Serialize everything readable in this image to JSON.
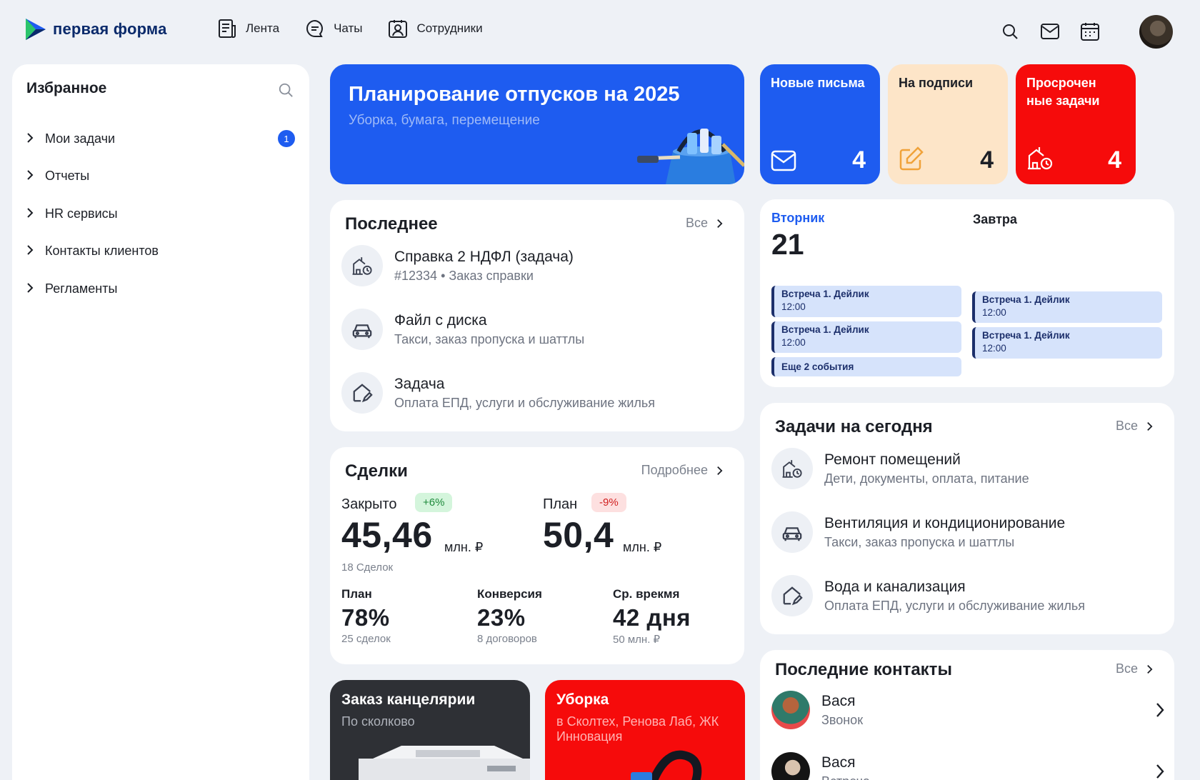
{
  "header": {
    "logo_text": "первая форма",
    "nav": [
      {
        "label": "Лента",
        "icon": "feed-icon"
      },
      {
        "label": "Чаты",
        "icon": "chat-icon"
      },
      {
        "label": "Сотрудники",
        "icon": "employees-icon"
      }
    ],
    "icons": [
      "search-icon",
      "mail-icon",
      "calendar-icon"
    ]
  },
  "sidebar": {
    "title": "Избранное",
    "items": [
      {
        "label": "Мои задачи",
        "badge": "1"
      },
      {
        "label": "Отчеты"
      },
      {
        "label": "HR сервисы"
      },
      {
        "label": "Контакты клиентов"
      },
      {
        "label": "Регламенты"
      }
    ]
  },
  "banner": {
    "title": "Планирование отпусков на 2025",
    "subtitle": "Уборка, бумага, перемещение"
  },
  "tiles": [
    {
      "title": "Новые письма",
      "count": "4",
      "bg": "#1e5cf0",
      "fg": "#ffffff",
      "icon": "mail-icon"
    },
    {
      "title": "На подписи",
      "count": "4",
      "bg": "#fde5c8",
      "fg": "#1c1f26",
      "icon": "edit-icon"
    },
    {
      "title": "Просрочен ные задачи",
      "count": "4",
      "bg": "#f60b0b",
      "fg": "#ffffff",
      "icon": "building-clock-icon"
    }
  ],
  "recent": {
    "title": "Последнее",
    "more": "Все",
    "items": [
      {
        "title": "Справка 2 НДФЛ (задача)",
        "sub_id": "#12334",
        "sub": "• Заказ справки",
        "icon": "building-clock-icon"
      },
      {
        "title": "Файл с диска",
        "sub": "Такси, заказ пропуска и шаттлы",
        "icon": "car-icon"
      },
      {
        "title": "Задача",
        "sub": "Оплата ЕПД, услуги и обслуживание жилья",
        "icon": "house-edit-icon"
      }
    ]
  },
  "deals": {
    "title": "Сделки",
    "more": "Подробнее",
    "closed": {
      "label": "Закрыто",
      "delta": "+6%",
      "value": "45,46",
      "unit": "млн. ₽",
      "count": "18 Сделок"
    },
    "plan": {
      "label": "План",
      "delta": "-9%",
      "value": "50,4",
      "unit": "млн. ₽"
    },
    "stats": [
      {
        "label": "План",
        "value": "78%",
        "sub": "25 сделок"
      },
      {
        "label": "Конверсия",
        "value": "23%",
        "sub": "8 договоров"
      },
      {
        "label": "Ср. врекмя",
        "value": "42 дня",
        "sub": "50 млн. ₽"
      }
    ]
  },
  "promos": [
    {
      "title": "Заказ канцелярии",
      "subtitle": "По сколково",
      "bg": "#2e3035"
    },
    {
      "title": "Уборка",
      "subtitle": "в Сколтех, Ренова Лаб, ЖК Инновация",
      "bg": "#f60b0b"
    }
  ],
  "calendar": {
    "today_label": "Вторник",
    "today_date": "21",
    "tomorrow_label": "Завтра",
    "today_events": [
      {
        "title": "Встреча 1. Дейлик",
        "time": "12:00"
      },
      {
        "title": "Встреча 1. Дейлик",
        "time": "12:00"
      }
    ],
    "today_more": "Еще 2 события",
    "tomorrow_events": [
      {
        "title": "Встреча 1. Дейлик",
        "time": "12:00"
      },
      {
        "title": "Встреча 1. Дейлик",
        "time": "12:00"
      }
    ]
  },
  "tasks": {
    "title": "Задачи на сегодня",
    "more": "Все",
    "items": [
      {
        "title": "Ремонт помещений",
        "sub": "Дети, документы, оплата, питание",
        "icon": "building-clock-icon"
      },
      {
        "title": "Вентиляция и кондиционирование",
        "sub": "Такси, заказ пропуска и шаттлы",
        "icon": "car-icon"
      },
      {
        "title": "Вода и канализация",
        "sub": "Оплата ЕПД, услуги и обслуживание жилья",
        "icon": "house-edit-icon"
      }
    ]
  },
  "contacts": {
    "title": "Последние контакты",
    "more": "Все",
    "items": [
      {
        "name": "Вася",
        "sub": "Звонок"
      },
      {
        "name": "Вася",
        "sub": "Встреча"
      }
    ]
  },
  "colors": {
    "accent": "#1e5cf0",
    "danger": "#f60b0b",
    "peach": "#fde5c8",
    "event_bg": "#d6e3fb",
    "event_fg": "#1c2f6b"
  }
}
